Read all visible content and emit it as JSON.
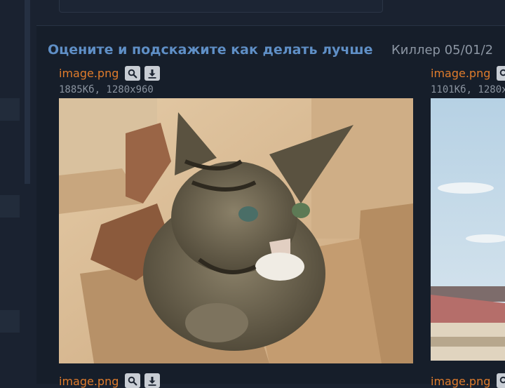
{
  "post": {
    "title": "Оцените и подскажите как делать лучше",
    "meta": "Киллер 05/01/2"
  },
  "attachments": [
    {
      "name": "image.png",
      "info": "1885Кб, 1280x960"
    },
    {
      "name": "image.png",
      "info": "1101Кб, 1280x"
    },
    {
      "name": "image.png",
      "info": ""
    },
    {
      "name": "image.png",
      "info": ""
    }
  ],
  "colors": {
    "title": "#5f8fc6",
    "attachment_link": "#e07c2c",
    "background": "#161e2a"
  }
}
